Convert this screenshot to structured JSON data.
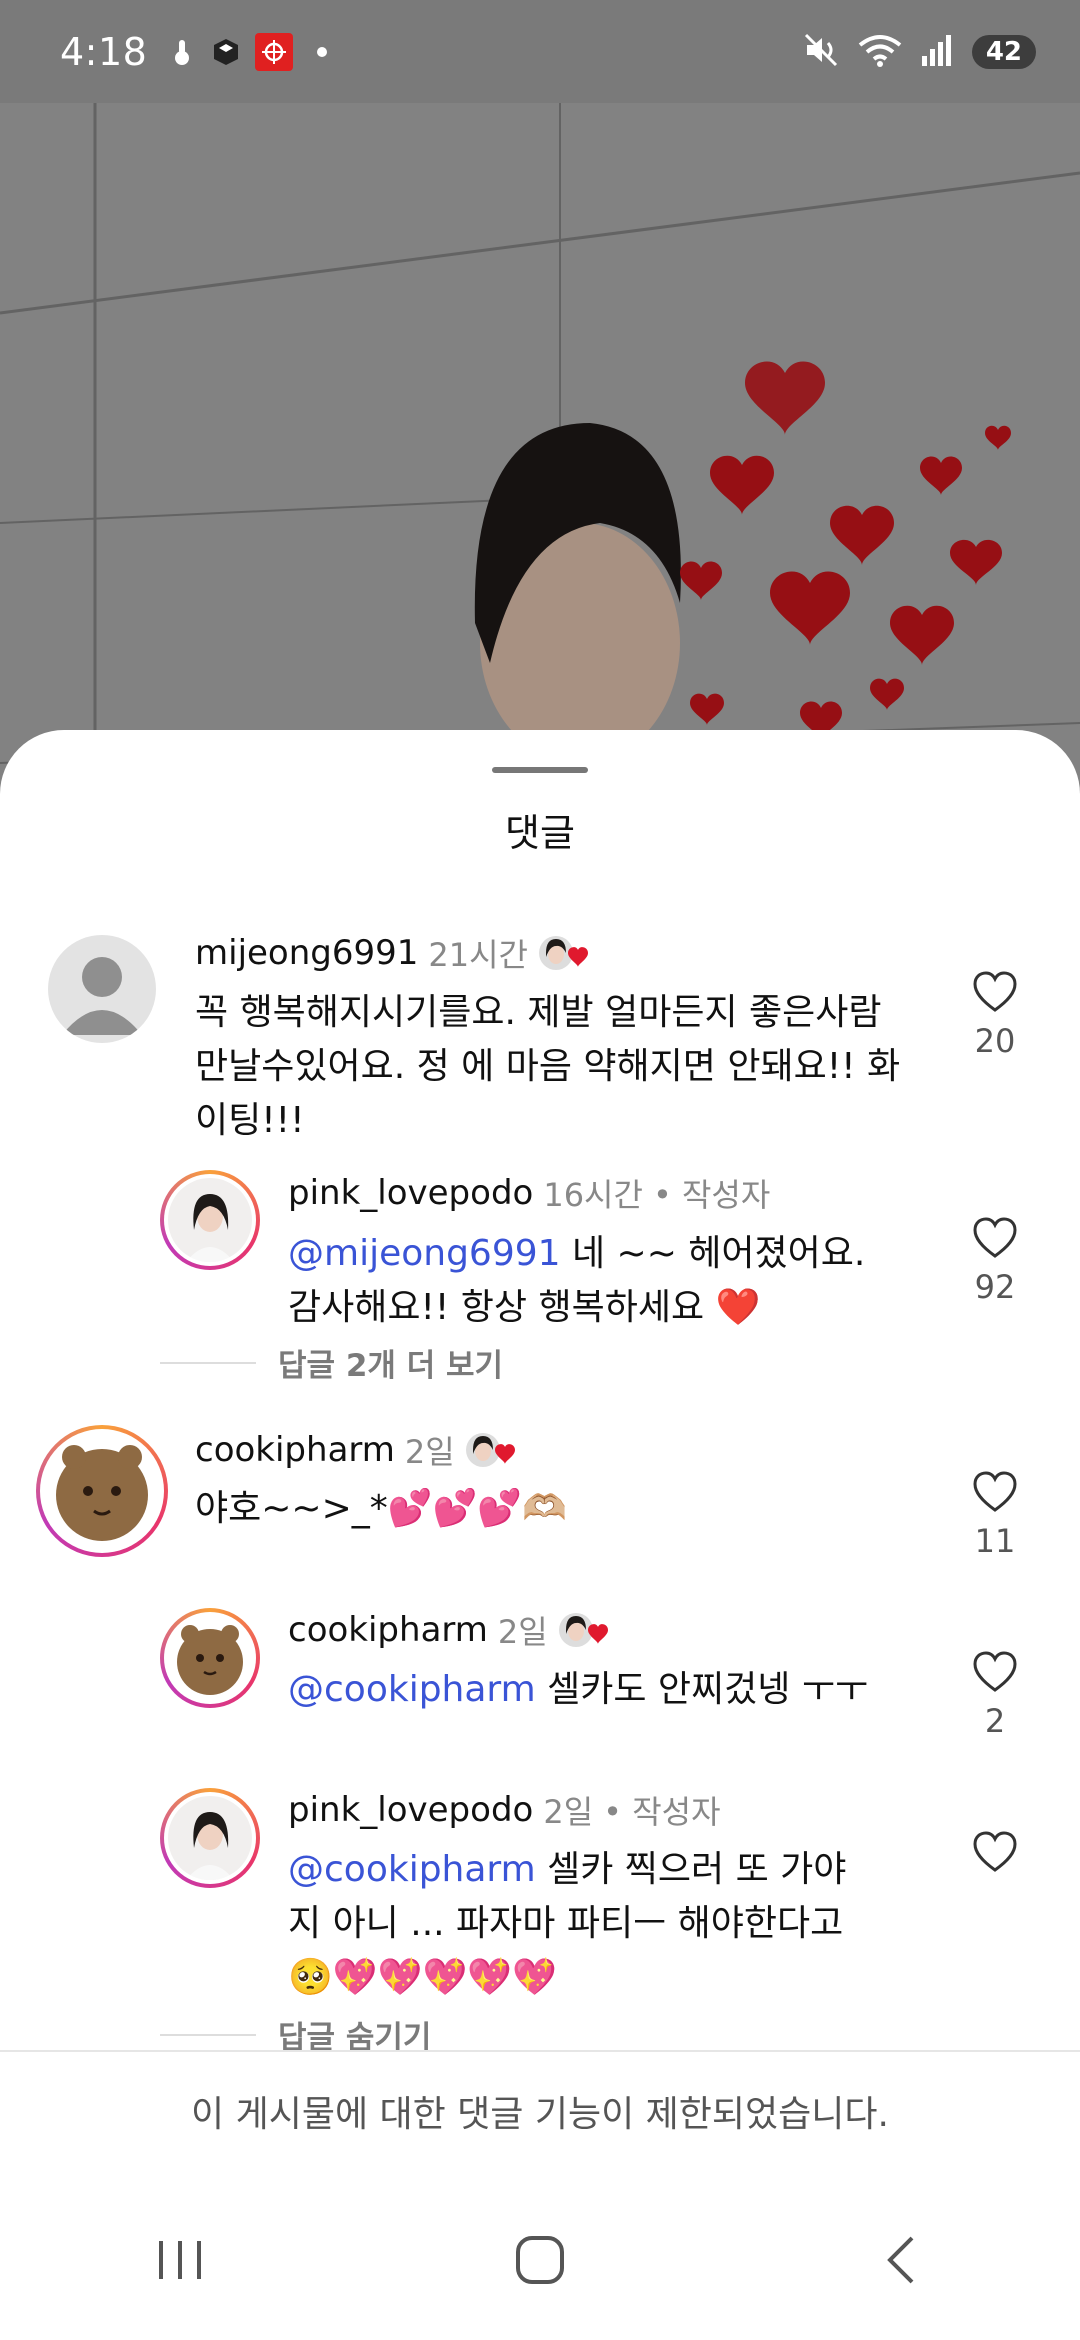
{
  "status": {
    "time": "4:18",
    "battery": "42",
    "icons": [
      "temperature-icon",
      "box-icon",
      "target-app-icon",
      "dot-icon"
    ],
    "right_icons": [
      "mute-icon",
      "wifi-icon",
      "signal-icon"
    ]
  },
  "sheet": {
    "title": "댓글"
  },
  "comments": [
    {
      "username": "mijeong6991",
      "time": "21시간",
      "text": "꼭 행복해지시기를요.  제발 얼마든지 좋은사람 만날수있어요. 정 에 마음 약해지면 안돼요!! 화이팅!!!",
      "likes": "20",
      "author_liked": true
    },
    {
      "username": "pink_lovepodo",
      "time": "16시간",
      "badge": "• 작성자",
      "mention": "@mijeong6991",
      "text": " 네 ~~ 헤어졌어요. 감사해요!! 항상 행복하세요 ❤️",
      "likes": "92",
      "more_replies": "답글 2개 더 보기"
    },
    {
      "username": "cookipharm",
      "time": "2일",
      "text": "야호~~>_*💕💕💕🫶🏼",
      "likes": "11",
      "author_liked": true
    },
    {
      "username": "cookipharm",
      "time": "2일",
      "mention": "@cookipharm",
      "text": " 셀카도 안찌겄넹 ㅜㅜ",
      "likes": "2",
      "author_liked": true
    },
    {
      "username": "pink_lovepodo",
      "time": "2일",
      "badge": "• 작성자",
      "mention": "@cookipharm",
      "text": " 셀카 찍으러 또 가야지 아니 ... 파자마 파티ㅡ 해야한다고 🥺💖💖💖💖💖",
      "likes": "",
      "hide_replies": "답글 숨기기"
    }
  ],
  "restricted_notice": "이 게시물에 대한 댓글 기능이 제한되었습니다.",
  "colors": {
    "mention": "#3a54d6",
    "heart": "#e0192e"
  }
}
